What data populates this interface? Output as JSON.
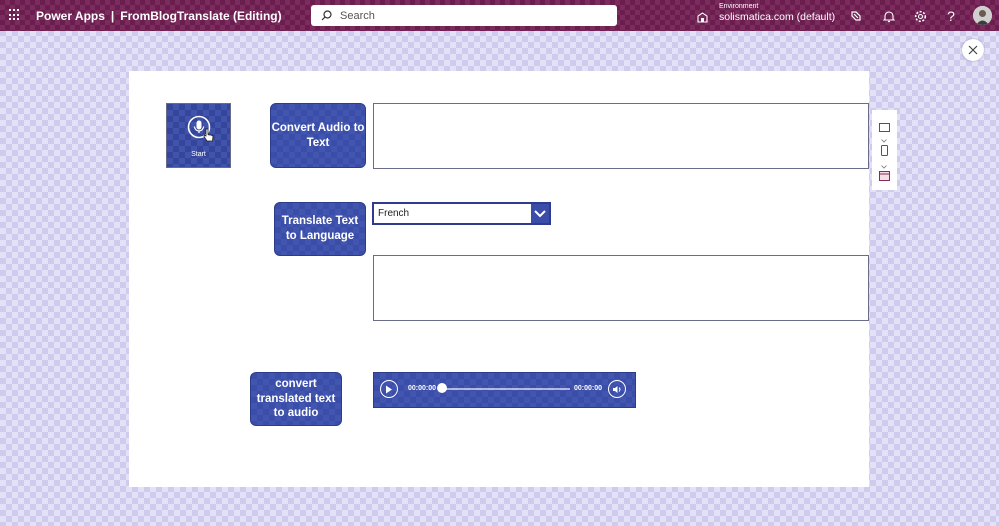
{
  "header": {
    "app_name": "Power Apps",
    "separator": "|",
    "doc_title": "FromBlogTranslate (Editing)",
    "search_placeholder": "Search",
    "environment_label": "Environment",
    "environment_name": "solismatica.com (default)",
    "help_label": "?"
  },
  "canvas": {
    "start_label": "Start",
    "convert_audio_button": "Convert Audio to Text",
    "translate_button": "Translate Text to Language",
    "convert_translated_button": "convert translated text to audio",
    "language_dropdown_value": "French",
    "transcribed_text": "",
    "translated_text": "",
    "audio_current_time": "00:00:00",
    "audio_total_time": "00:00:00"
  },
  "colors": {
    "topbar": "#6b1d4e",
    "button_fill": "#3a4da8",
    "canvas_bg": "#ffffff",
    "page_bg": "#e3e1f7"
  }
}
